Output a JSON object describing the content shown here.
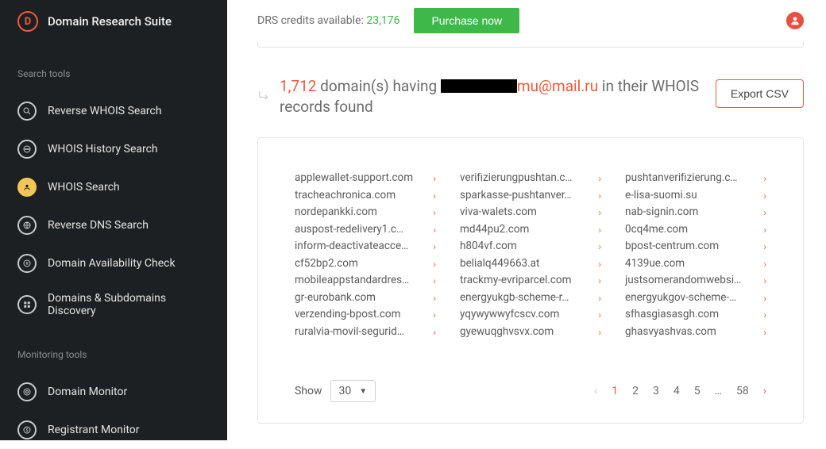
{
  "app": {
    "title": "Domain Research Suite",
    "logo_letter": "D"
  },
  "sidebar": {
    "search_section": "Search tools",
    "monitor_section": "Monitoring tools",
    "search_items": [
      {
        "label": "Reverse WHOIS Search",
        "icon": "search",
        "active": false
      },
      {
        "label": "WHOIS History Search",
        "icon": "history",
        "active": false
      },
      {
        "label": "WHOIS Search",
        "icon": "whois",
        "active": true
      },
      {
        "label": "Reverse DNS Search",
        "icon": "globe",
        "active": false
      },
      {
        "label": "Domain Availability Check",
        "icon": "register",
        "active": false
      },
      {
        "label": "Domains & Subdomains Discovery",
        "icon": "grid",
        "active": false
      }
    ],
    "monitor_items": [
      {
        "label": "Domain Monitor",
        "icon": "monitor"
      },
      {
        "label": "Registrant Monitor",
        "icon": "registrant"
      }
    ]
  },
  "topbar": {
    "credits_label": "DRS credits available:",
    "credits_value": "23,176",
    "purchase_label": "Purchase now"
  },
  "results": {
    "count": "1,712",
    "sentence_part1": " domain(s) having ",
    "email_suffix": "mu@mail.ru",
    "sentence_part2": " in their WHOIS records found",
    "export_label": "Export CSV"
  },
  "domains": {
    "col1": [
      "applewallet-support.com",
      "tracheachronica.com",
      "nordepankki.com",
      "auspost-redelivery1.c…",
      "inform-deactivateacce…",
      "cf52bp2.com",
      "mobileappstandardres…",
      "gr-eurobank.com",
      "verzending-bpost.com",
      "ruralvia-movil-segurid…"
    ],
    "col2": [
      "verifizierungpushtan.c…",
      "sparkasse-pushtanver…",
      "viva-walets.com",
      "md44pu2.com",
      "h804vf.com",
      "belialq449663.at",
      "trackmy-evriparcel.com",
      "energyukgb-scheme-r…",
      "yqywywwyfcscv.com",
      "gyewuqghvsvx.com"
    ],
    "col3": [
      "pushtanverifizierung.c…",
      "e-lisa-suomi.su",
      "nab-signin.com",
      "0cq4me.com",
      "bpost-centrum.com",
      "4139ue.com",
      "justsomerandomwebsi…",
      "energyukgov-scheme-…",
      "sfhasgiasasgh.com",
      "ghasvyashvas.com"
    ]
  },
  "pagination": {
    "show_label": "Show",
    "page_size": "30",
    "pages": [
      "1",
      "2",
      "3",
      "4",
      "5",
      "…",
      "58"
    ],
    "current": "1"
  }
}
